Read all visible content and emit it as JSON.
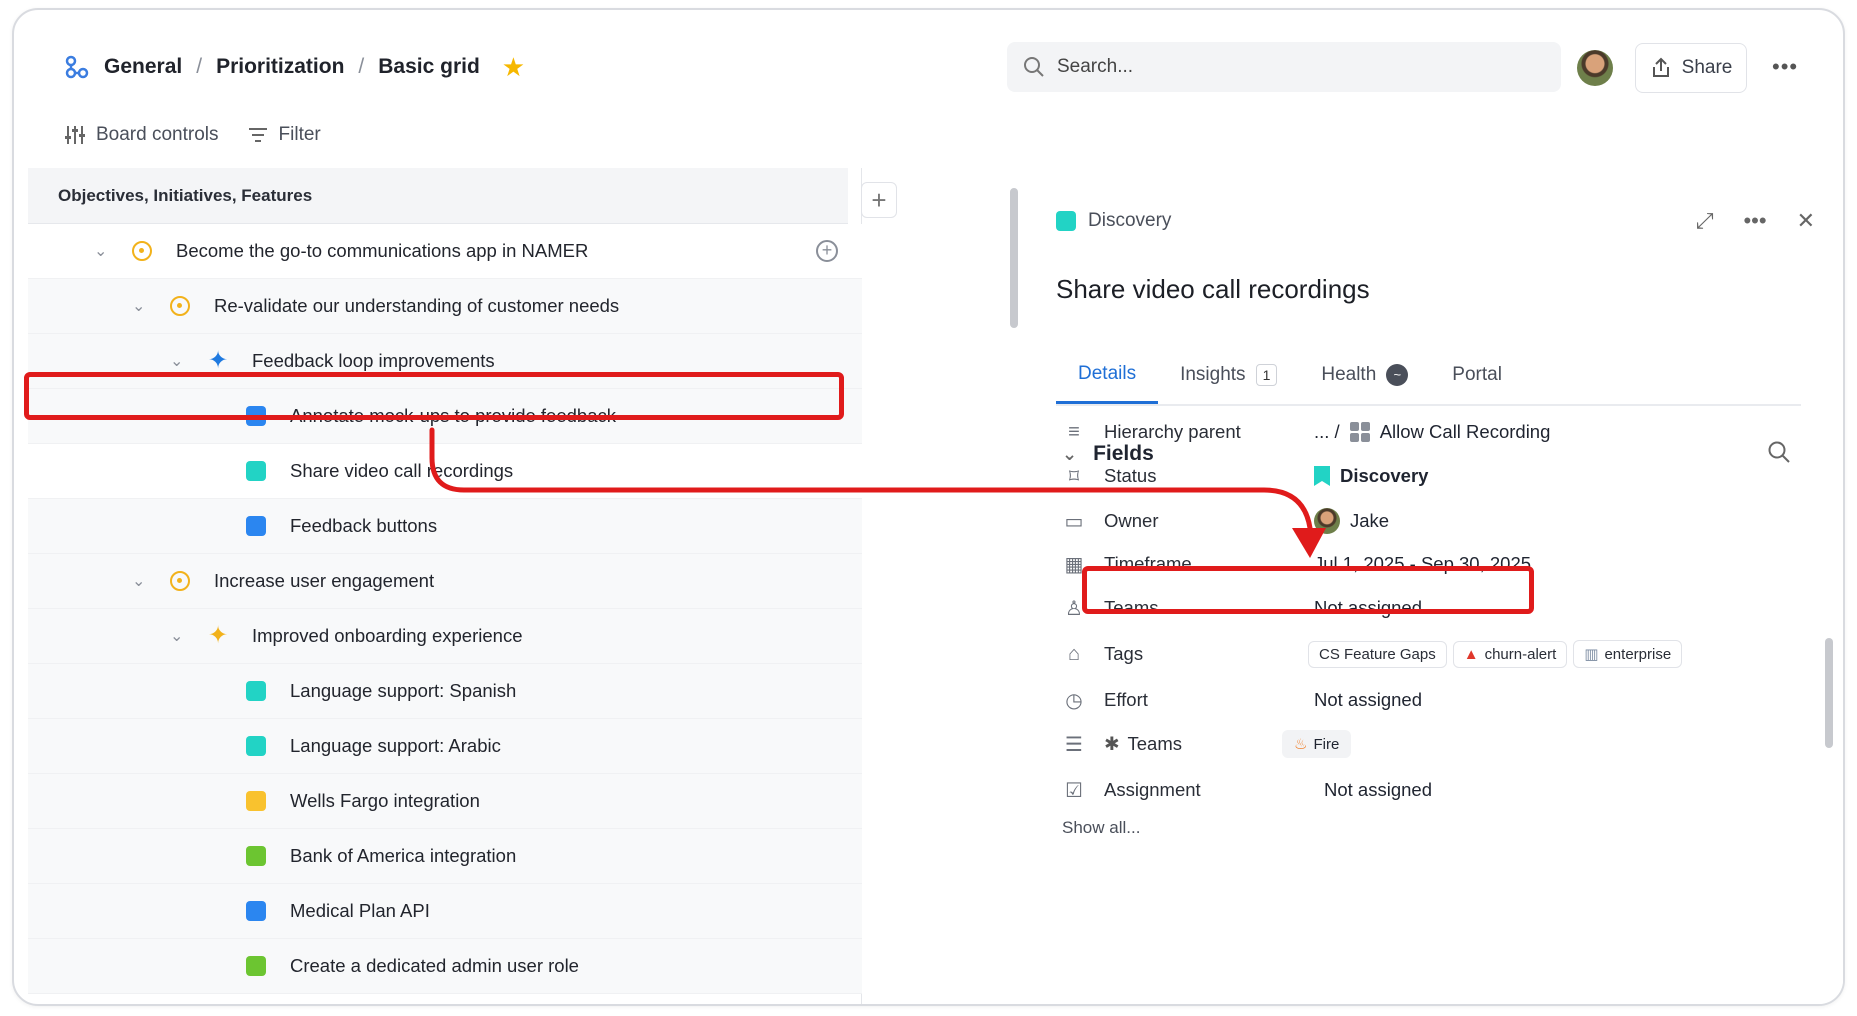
{
  "breadcrumb": {
    "items": [
      "General",
      "Prioritization",
      "Basic grid"
    ],
    "separator": "/"
  },
  "search": {
    "placeholder": "Search..."
  },
  "share_label": "Share",
  "toolbar": {
    "board_controls": "Board controls",
    "filter": "Filter"
  },
  "grid": {
    "header": "Objectives, Initiatives, Features",
    "rows": [
      {
        "label": "Become the go-to communications app in NAMER",
        "icon": "objective-icon",
        "level": 0,
        "color": "#f2b21b"
      },
      {
        "label": "Re-validate our understanding of customer needs",
        "icon": "objective-icon",
        "level": 1,
        "color": "#f2b21b"
      },
      {
        "label": "Feedback loop improvements",
        "icon": "initiative-icon",
        "level": 2,
        "color": "#1f7ae0"
      },
      {
        "label": "Annotate mock-ups to provide feedback",
        "icon": "feature-icon",
        "level": 3,
        "color": "#2b86f0"
      },
      {
        "label": "Share video call recordings",
        "icon": "feature-icon",
        "level": 3,
        "color": "#22d3c5"
      },
      {
        "label": "Feedback buttons",
        "icon": "feature-icon",
        "level": 3,
        "color": "#2b86f0"
      },
      {
        "label": "Increase user engagement",
        "icon": "objective-icon",
        "level": 1,
        "color": "#f2b21b"
      },
      {
        "label": "Improved onboarding experience",
        "icon": "initiative-icon",
        "level": 2,
        "color": "#f2b21b"
      },
      {
        "label": "Language support: Spanish",
        "icon": "feature-icon",
        "level": 3,
        "color": "#22d3c5"
      },
      {
        "label": "Language support: Arabic",
        "icon": "feature-icon",
        "level": 3,
        "color": "#22d3c5"
      },
      {
        "label": "Wells Fargo integration",
        "icon": "feature-icon",
        "level": 3,
        "color": "#f9c22e"
      },
      {
        "label": "Bank of America integration",
        "icon": "feature-icon",
        "level": 3,
        "color": "#6cc531"
      },
      {
        "label": "Medical Plan API",
        "icon": "feature-icon",
        "level": 3,
        "color": "#2b86f0"
      },
      {
        "label": "Create a dedicated admin user role",
        "icon": "feature-icon",
        "level": 3,
        "color": "#6cc531"
      }
    ]
  },
  "panel": {
    "status": "Discovery",
    "title": "Share video call recordings",
    "tabs": [
      {
        "label": "Details",
        "active": true
      },
      {
        "label": "Insights",
        "badge": "1"
      },
      {
        "label": "Health"
      },
      {
        "label": "Portal"
      }
    ],
    "fields_title": "Fields",
    "fields": {
      "hierarchy_parent": {
        "name": "Hierarchy parent",
        "prefix": "... /",
        "value": "Allow Call Recording"
      },
      "status": {
        "name": "Status",
        "value": "Discovery"
      },
      "owner": {
        "name": "Owner",
        "value": "Jake"
      },
      "timeframe": {
        "name": "Timeframe",
        "value": "Jul 1, 2025 - Sep 30, 2025"
      },
      "teams": {
        "name": "Teams",
        "value": "Not assigned"
      },
      "tags": {
        "name": "Tags",
        "values": [
          "CS Feature Gaps",
          "churn-alert",
          "enterprise"
        ]
      },
      "effort": {
        "name": "Effort",
        "value": "Not assigned"
      },
      "teams2": {
        "name": "Teams",
        "value": "Fire"
      },
      "assignment": {
        "name": "Assignment",
        "value": "Not assigned"
      }
    },
    "show_all": "Show all..."
  },
  "colors": {
    "accent": "#1f6fd6",
    "annotation": "#e01b1b",
    "teal": "#22d3c5"
  }
}
